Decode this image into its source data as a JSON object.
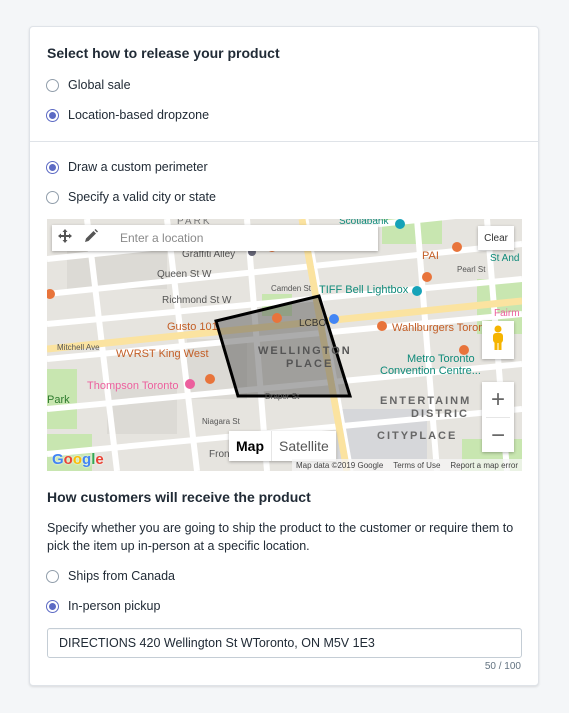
{
  "release": {
    "heading": "Select how to release your product",
    "options": [
      {
        "label": "Global sale",
        "checked": false
      },
      {
        "label": "Location-based dropzone",
        "checked": true
      }
    ]
  },
  "perimeter": {
    "options": [
      {
        "label": "Draw a custom perimeter",
        "checked": true
      },
      {
        "label": "Specify a valid city or state",
        "checked": false
      }
    ]
  },
  "map": {
    "search_placeholder": "Enter a location",
    "clear_label": "Clear",
    "map_type_active": "Map",
    "map_type_inactive": "Satellite",
    "zoom_in": "+",
    "zoom_out": "−",
    "logo": "Google",
    "attribution": {
      "data": "Map data ©2019 Google",
      "terms": "Terms of Use",
      "report": "Report a map error"
    },
    "labels": {
      "park": "PARK",
      "scotiabank": "Scotiabank",
      "graffiti": "Graffiti Alley",
      "queen": "Queen St W",
      "richmond": "Richmond St W",
      "camden": "Camden St",
      "tiff": "TIFF Bell Lightbox",
      "pai": "PAI",
      "st_and": "St And",
      "pearl": "Pearl St",
      "gusto": "Gusto 101",
      "lcbo": "LCBO",
      "wahlburgers": "Wahlburgers Toronto",
      "fairm": "Fairm",
      "mitchell": "Mitchell Ave",
      "wvrst": "WVRST King West",
      "wellington": "WELLINGTON",
      "place": "PLACE",
      "metro1": "Metro Toronto",
      "metro2": "Convention Centre...",
      "thompson": "Thompson Toronto",
      "park2": "Park",
      "draper": "Draper St",
      "niagara": "Niagara St",
      "entertain": "ENTERTAINM",
      "district": "DISTRIC",
      "cityplace": "CITYPLACE",
      "front": "Front"
    }
  },
  "receive": {
    "heading": "How customers will receive the product",
    "description": "Specify whether you are going to ship the product to the customer or require them to pick the item up in-person at a specific location.",
    "options": [
      {
        "label": "Ships from Canada",
        "checked": false
      },
      {
        "label": "In-person pickup",
        "checked": true
      }
    ],
    "address_value": "DIRECTIONS 420 Wellington St WToronto, ON M5V 1E3",
    "counter": "50 / 100"
  },
  "colors": {
    "accent": "#5c6ac4",
    "map_park": "#c8e6b0",
    "map_road": "#ffffff",
    "map_major_road": "#fbe3a0",
    "perimeter_stroke": "#000000"
  }
}
